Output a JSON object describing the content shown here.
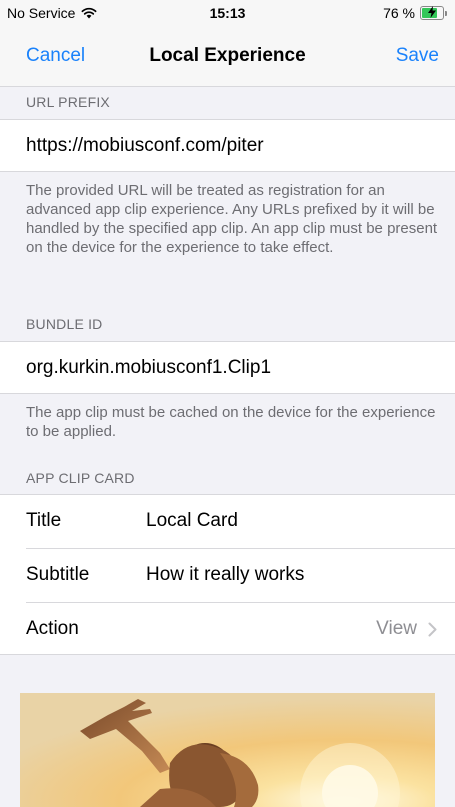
{
  "status_bar": {
    "carrier": "No Service",
    "time": "15:13",
    "battery": "76 %",
    "battery_level": 0.76
  },
  "nav": {
    "cancel_label": "Cancel",
    "title": "Local Experience",
    "save_label": "Save"
  },
  "url_prefix": {
    "header": "URL PREFIX",
    "value": "https://mobiusconf.com/piter",
    "footer": "The provided URL will be treated as registration for an advanced app clip experience. Any URLs prefixed by it will be handled by the specified app clip. An app clip must be present on the device for the experience to take effect."
  },
  "bundle_id": {
    "header": "BUNDLE ID",
    "value": "org.kurkin.mobiusconf1.Clip1",
    "footer": "The app clip must be cached on the device for the experience to be applied."
  },
  "app_clip_card": {
    "header": "APP CLIP CARD",
    "rows": [
      {
        "label": "Title",
        "value": "Local Card"
      },
      {
        "label": "Subtitle",
        "value": "How it really works"
      },
      {
        "label": "Action",
        "value": "View"
      }
    ]
  },
  "colors": {
    "accent": "#1a82fb",
    "background": "#f2f2f7",
    "secondary_text": "#6d6d72",
    "battery_fill": "#34c759"
  }
}
